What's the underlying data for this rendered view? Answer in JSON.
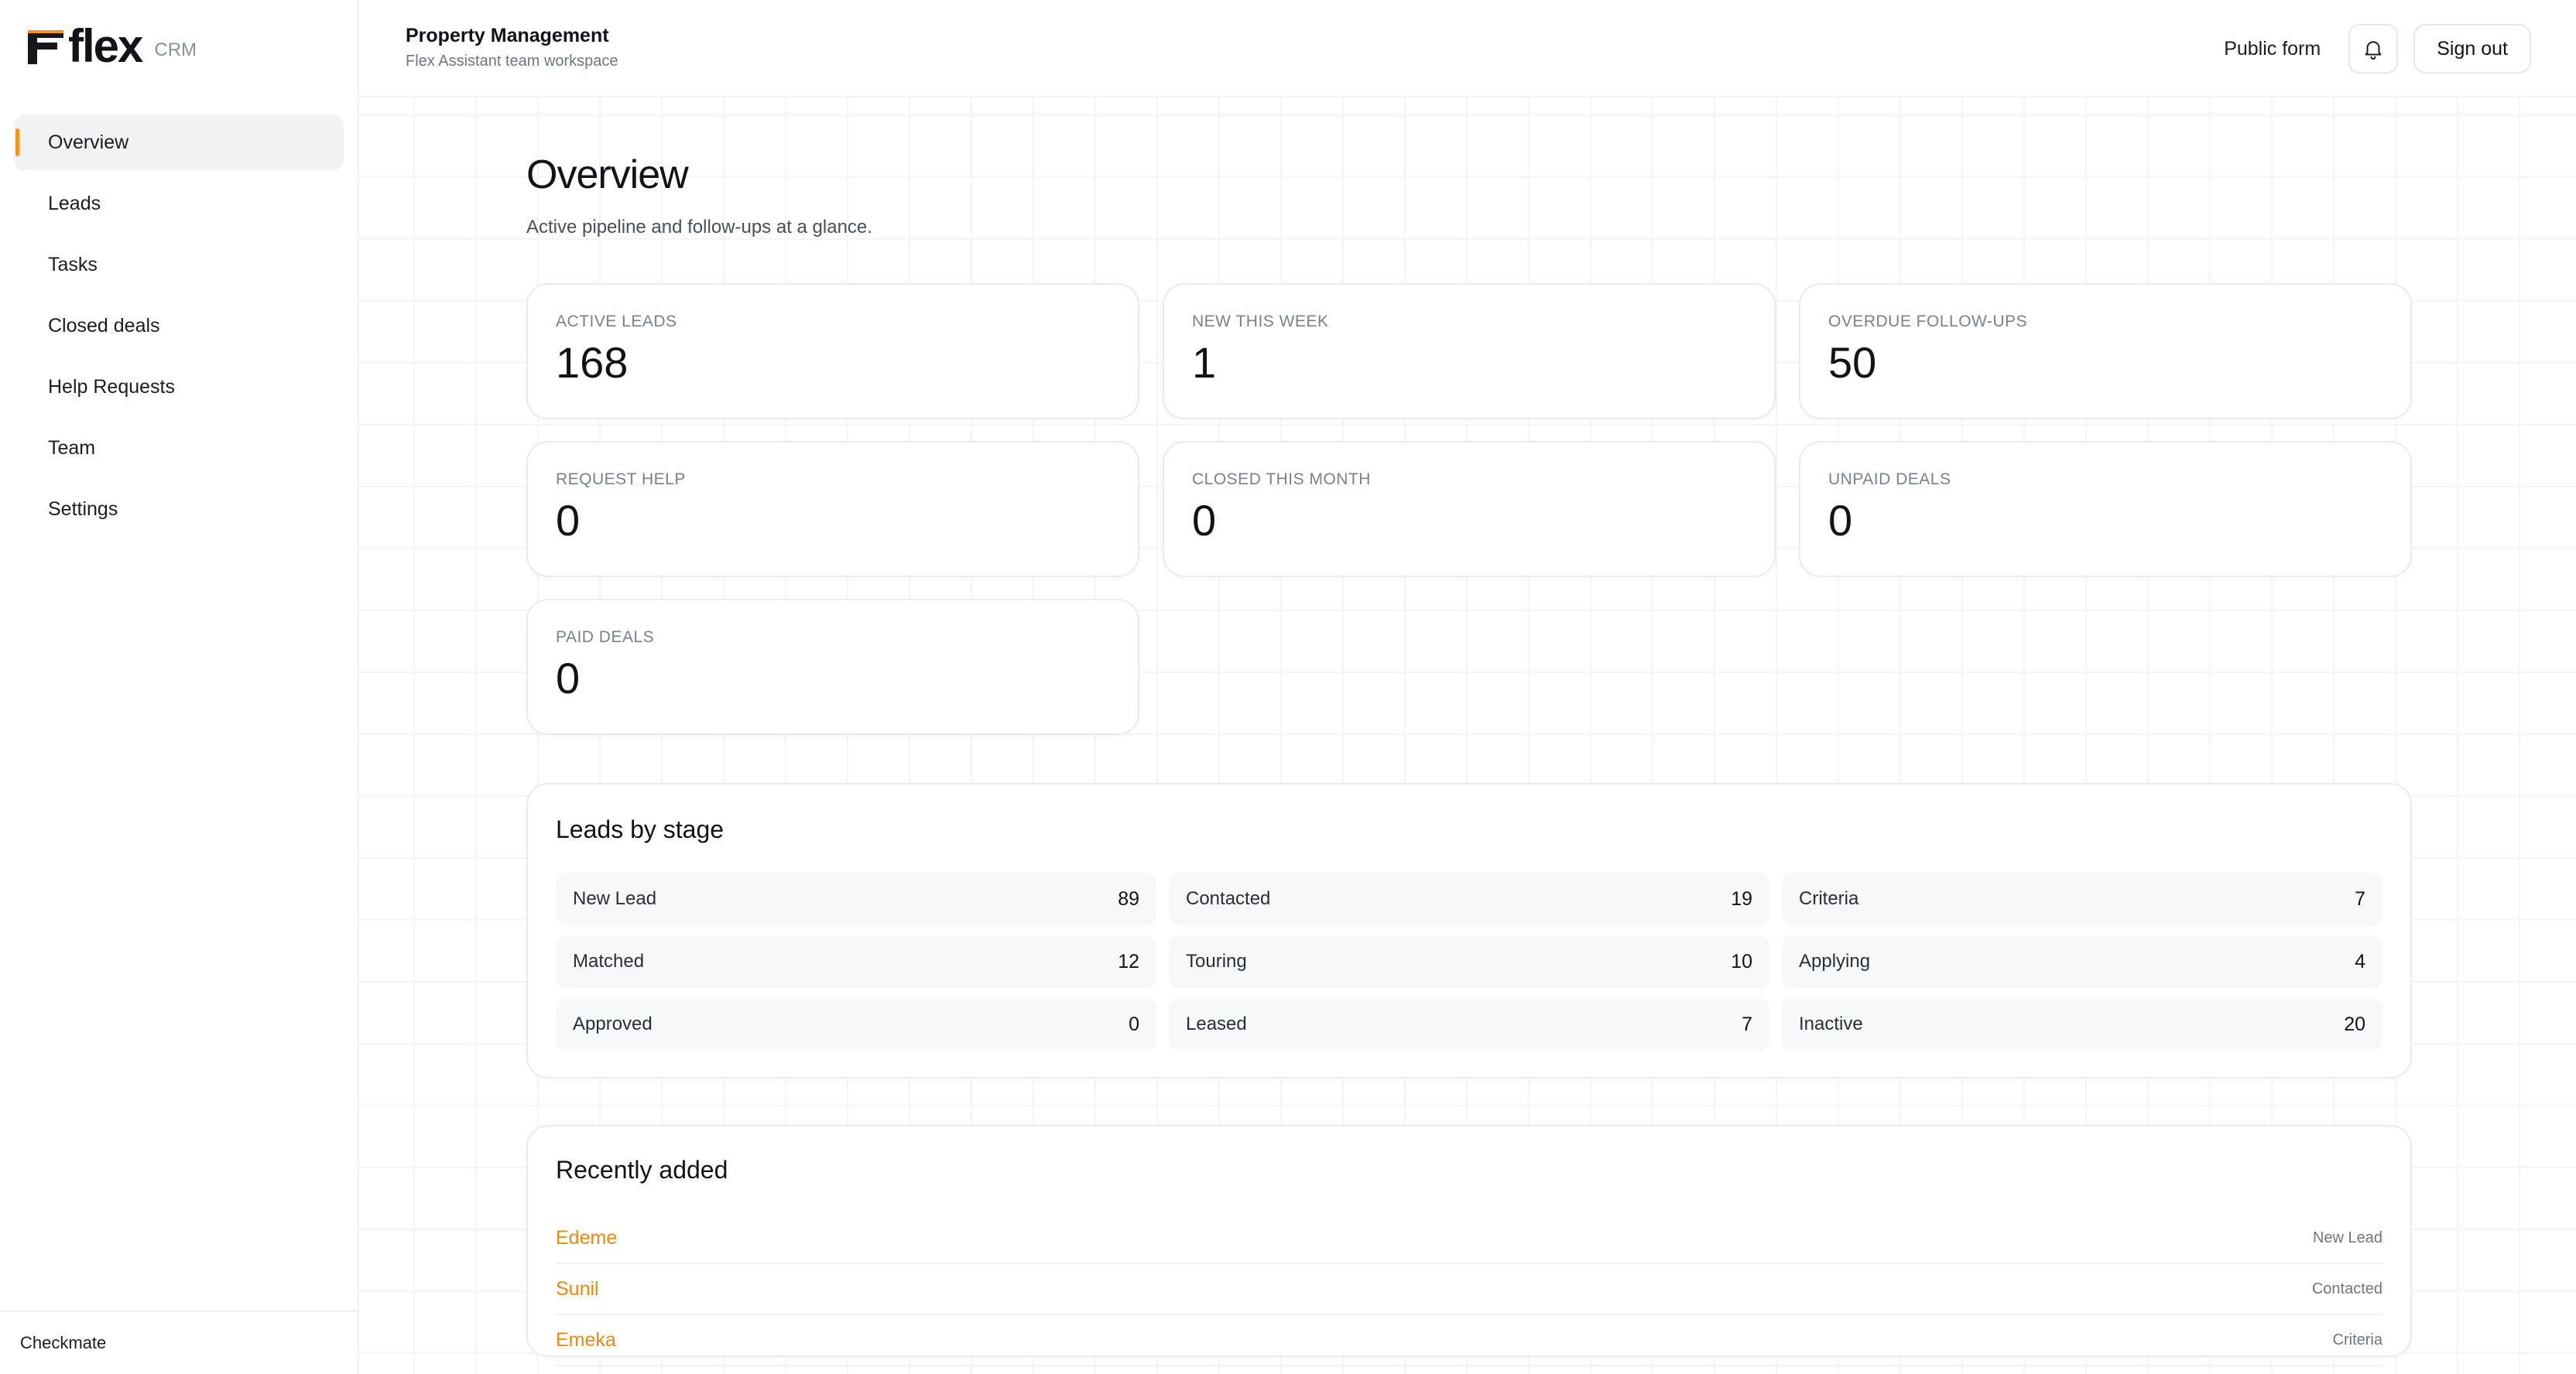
{
  "brand": {
    "word": "flex",
    "suffix": "CRM",
    "accent": "#f0961b"
  },
  "sidebar": {
    "items": [
      {
        "label": "Overview",
        "active": true
      },
      {
        "label": "Leads"
      },
      {
        "label": "Tasks"
      },
      {
        "label": "Closed deals"
      },
      {
        "label": "Help Requests"
      },
      {
        "label": "Team"
      },
      {
        "label": "Settings"
      }
    ],
    "footer": "Checkmate"
  },
  "header": {
    "title": "Property Management",
    "subtitle": "Flex Assistant team workspace",
    "public_form": "Public form",
    "sign_out": "Sign out",
    "bell_icon": "bell-icon"
  },
  "page": {
    "title": "Overview",
    "subtitle": "Active pipeline and follow-ups at a glance."
  },
  "stats": [
    {
      "label": "ACTIVE LEADS",
      "value": "168"
    },
    {
      "label": "NEW THIS WEEK",
      "value": "1"
    },
    {
      "label": "OVERDUE FOLLOW-UPS",
      "value": "50"
    },
    {
      "label": "REQUEST HELP",
      "value": "0"
    },
    {
      "label": "CLOSED THIS MONTH",
      "value": "0"
    },
    {
      "label": "UNPAID DEALS",
      "value": "0"
    },
    {
      "label": "PAID DEALS",
      "value": "0"
    }
  ],
  "stages": {
    "title": "Leads by stage",
    "items": [
      {
        "name": "New Lead",
        "count": "89"
      },
      {
        "name": "Contacted",
        "count": "19"
      },
      {
        "name": "Criteria",
        "count": "7"
      },
      {
        "name": "Matched",
        "count": "12"
      },
      {
        "name": "Touring",
        "count": "10"
      },
      {
        "name": "Applying",
        "count": "4"
      },
      {
        "name": "Approved",
        "count": "0"
      },
      {
        "name": "Leased",
        "count": "7"
      },
      {
        "name": "Inactive",
        "count": "20"
      }
    ]
  },
  "recent": {
    "title": "Recently added",
    "items": [
      {
        "name": "Edeme",
        "stage": "New Lead"
      },
      {
        "name": "Sunil",
        "stage": "Contacted"
      },
      {
        "name": "Emeka",
        "stage": "Criteria"
      }
    ]
  }
}
